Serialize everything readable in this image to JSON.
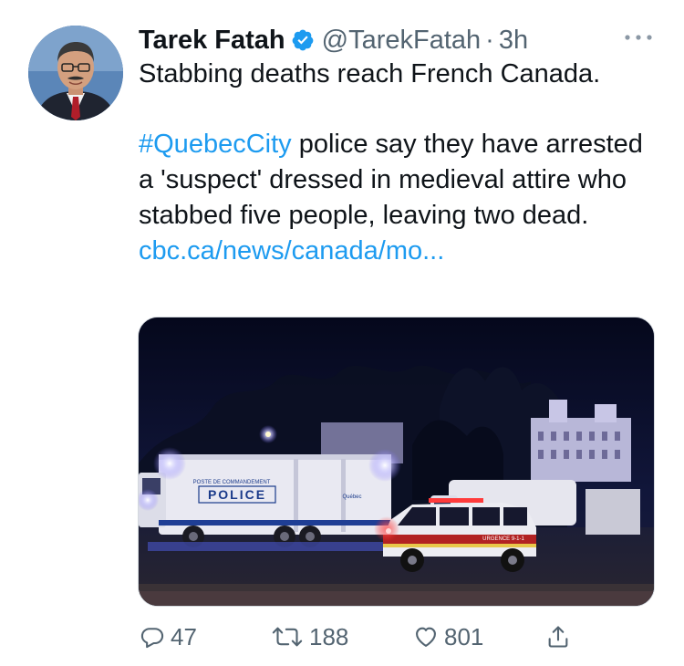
{
  "author": {
    "name": "Tarek Fatah",
    "handle": "@TarekFatah",
    "separator": "·",
    "time": "3h",
    "verified": true
  },
  "tweet": {
    "line1": "Stabbing deaths reach French Canada.",
    "hashtag": "#QuebecCity",
    "text_after_hashtag": " police say they have arrested a 'suspect' dressed in medieval attire who stabbed five people, leaving two dead.",
    "link": "cbc.ca/news/canada/mo..."
  },
  "media": {
    "vehicle_label_small": "POSTE DE COMMANDEMENT",
    "vehicle_label_big": "POLICE",
    "vehicle_brand": "Québec",
    "suv_label": "URGENCE 9-1-1"
  },
  "actions": {
    "replies": "47",
    "retweets": "188",
    "likes": "801"
  },
  "icons": {
    "verified": "verified-badge-icon",
    "more": "more-options-icon",
    "reply": "reply-icon",
    "retweet": "retweet-icon",
    "like": "heart-icon",
    "share": "share-icon"
  },
  "colors": {
    "accent": "#1d9bf0",
    "secondary_text": "#536471",
    "primary_text": "#0f1419"
  }
}
